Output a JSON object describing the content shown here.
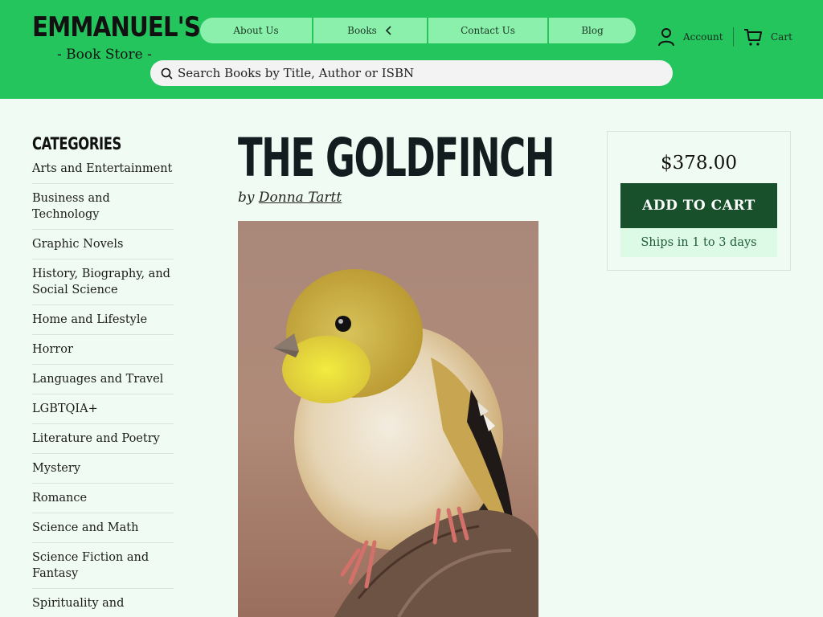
{
  "brand": {
    "name": "EMMANUEL'S",
    "subtitle": "- Book Store -"
  },
  "nav": {
    "items": [
      "About Us",
      "Books",
      "Contact Us",
      "Blog"
    ]
  },
  "account": {
    "label": "Account",
    "icon": "user-icon"
  },
  "cart": {
    "label": "Cart",
    "icon": "cart-icon"
  },
  "search": {
    "placeholder": "Search Books by Title, Author or ISBN",
    "icon": "search-icon"
  },
  "sidebar": {
    "title": "CATEGORIES",
    "items": [
      "Arts and Entertainment",
      "Business and Technology",
      "Graphic Novels",
      "History, Biography, and Social Science",
      "Home and Lifestyle",
      "Horror",
      "Languages and Travel",
      "LGBTQIA+",
      "Literature and Poetry",
      "Mystery",
      "Romance",
      "Science and Math",
      "Science Fiction and Fantasy",
      "Spirituality and"
    ]
  },
  "book": {
    "title": "THE GOLDFINCH",
    "by": "by",
    "author": "Donna Tartt"
  },
  "buy": {
    "price": "$378.00",
    "add_to_cart": "ADD TO CART",
    "shipping": "Ships in 1 to 3 days"
  },
  "colors": {
    "header_bg": "#25c55e",
    "nav_bg": "#8cf0ad",
    "page_bg": "#f0fcf3",
    "button_bg": "#17502a",
    "ships_bg": "#ddfae6"
  }
}
